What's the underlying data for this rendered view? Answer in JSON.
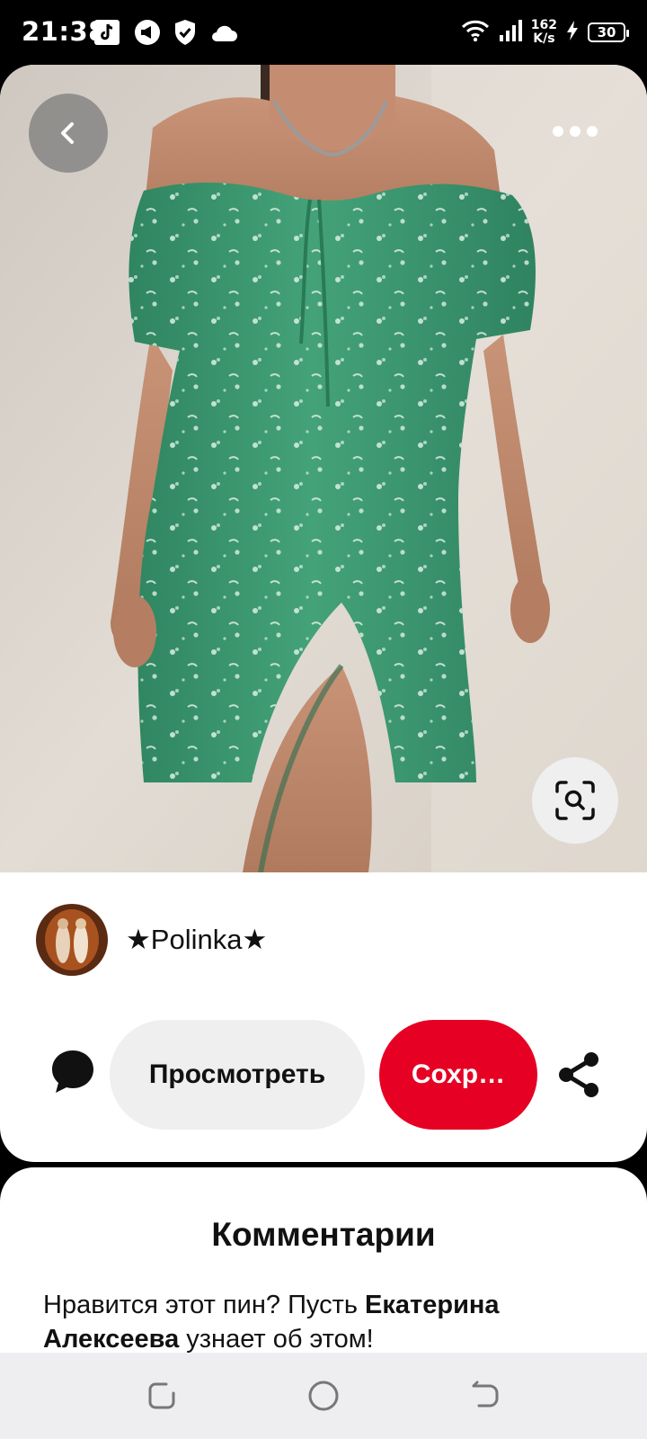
{
  "status_bar": {
    "time": "21:38",
    "net_speed_value": "162",
    "net_speed_unit": "K/s",
    "battery": "30",
    "icons": [
      "tiktok-icon",
      "megaphone-icon",
      "shield-check-icon",
      "cloud-icon",
      "wifi-icon",
      "signal-icon",
      "charging-icon"
    ]
  },
  "pin": {
    "image_description_icons": [
      "back-icon",
      "more-icon",
      "visual-search-icon"
    ],
    "creator_name": "★Polinka★",
    "view_label": "Просмотреть",
    "save_label": "Сохр…"
  },
  "comments": {
    "title": "Комментарии",
    "text_before": "Нравится этот пин? Пусть ",
    "mention": "Екатерина Алексеева",
    "text_after": " узнает об этом!"
  },
  "colors": {
    "accent_red": "#e60023",
    "button_gray": "#efefef",
    "dress_green": "#3f9d72"
  }
}
